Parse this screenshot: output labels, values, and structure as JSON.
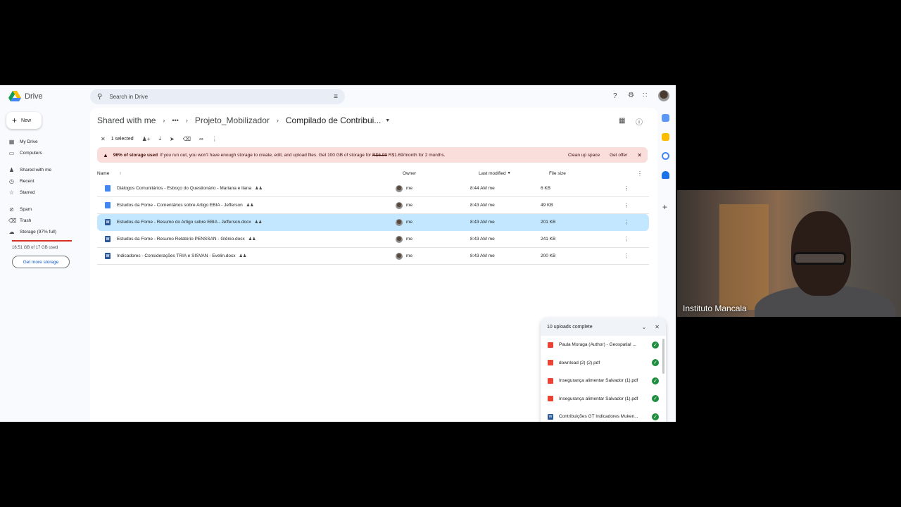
{
  "app": {
    "name": "Drive"
  },
  "search": {
    "placeholder": "Search in Drive"
  },
  "sidebar": {
    "new_label": "New",
    "items": [
      {
        "label": "My Drive",
        "icon": "my-drive-icon"
      },
      {
        "label": "Computers",
        "icon": "computer-icon"
      },
      {
        "label": "Shared with me",
        "icon": "people-icon"
      },
      {
        "label": "Recent",
        "icon": "clock-icon"
      },
      {
        "label": "Starred",
        "icon": "star-icon"
      },
      {
        "label": "Spam",
        "icon": "spam-icon"
      },
      {
        "label": "Trash",
        "icon": "trash-icon"
      },
      {
        "label": "Storage (97% full)",
        "icon": "cloud-icon"
      }
    ],
    "storage_text": "16.51 GB of 17 GB used",
    "get_storage_label": "Get more storage"
  },
  "breadcrumb": {
    "items": [
      "Shared with me",
      "Projeto_Mobilizador",
      "Compilado de Contribui..."
    ],
    "more": "•••"
  },
  "selection": {
    "count_label": "1 selected"
  },
  "warning": {
    "bold": "96% of storage used",
    "text": "If you run out, you won't have enough storage to create, edit, and upload files. Get 100 GB of storage for",
    "old_price": "R$6.99",
    "new_price": "R$1.69/month for 2 months.",
    "clean_label": "Clean up space",
    "offer_label": "Get offer"
  },
  "table": {
    "headers": {
      "name": "Name",
      "owner": "Owner",
      "modified": "Last modified",
      "size": "File size"
    },
    "rows": [
      {
        "type": "doc",
        "name": "Diálogos Comunitários - Esboço do Questionário - Mariana e Ilana",
        "owner": "me",
        "modified": "8:44 AM",
        "modified_by": "me",
        "size": "6 KB",
        "selected": false
      },
      {
        "type": "doc",
        "name": "Estudos da Fome - Comentários sobre Artigo EBIA - Jefferson",
        "owner": "me",
        "modified": "8:43 AM",
        "modified_by": "me",
        "size": "49 KB",
        "selected": false
      },
      {
        "type": "word",
        "name": "Estudos da Fome - Resumo do Artigo sobre EBIA - Jefferson.docx",
        "owner": "me",
        "modified": "8:43 AM",
        "modified_by": "me",
        "size": "201 KB",
        "selected": true
      },
      {
        "type": "word",
        "name": "Estudos da Fome - Resumo Relatório PENSSAN - Glênio.docx",
        "owner": "me",
        "modified": "8:43 AM",
        "modified_by": "me",
        "size": "241 KB",
        "selected": false
      },
      {
        "type": "word",
        "name": "Indicadores - Considerações TRIA e SISVAN - Evelin.docx",
        "owner": "me",
        "modified": "8:43 AM",
        "modified_by": "me",
        "size": "200 KB",
        "selected": false
      }
    ]
  },
  "uploads": {
    "title": "10 uploads complete",
    "items": [
      {
        "type": "pdf",
        "name": "Paula Moraga (Author) - Geospatial ..."
      },
      {
        "type": "pdf",
        "name": "download (2) (2).pdf"
      },
      {
        "type": "pdf",
        "name": "Insegurança alimentar Salvador (1).pdf"
      },
      {
        "type": "pdf",
        "name": "Insegurança alimentar Salvador (1).pdf"
      },
      {
        "type": "word",
        "name": "Contribuições GT Indicadores Muken..."
      }
    ]
  },
  "webcam": {
    "name": "Instituto Mancala"
  },
  "colors": {
    "accent": "#0b57d0",
    "selected_row": "#c2e7ff",
    "warning_bg": "#f9dedc",
    "success": "#1e8e3e"
  }
}
